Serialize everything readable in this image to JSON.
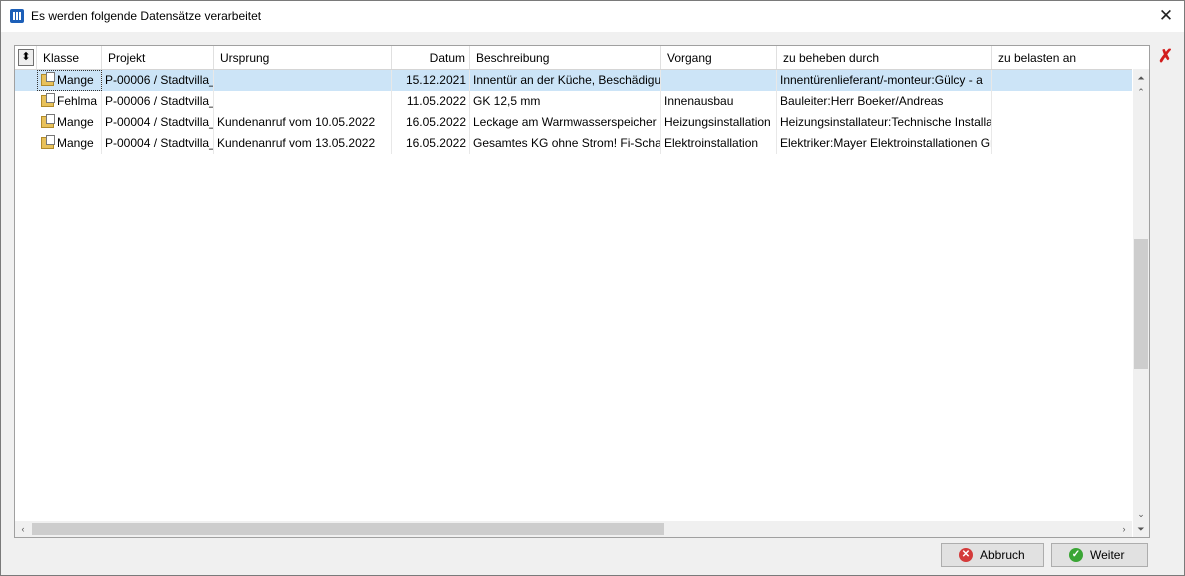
{
  "window": {
    "title": "Es werden folgende Datensätze verarbeitet"
  },
  "columns": [
    "Klasse",
    "Projekt",
    "Ursprung",
    "Datum",
    "Beschreibung",
    "Vorgang",
    "zu beheben durch",
    "zu belasten an"
  ],
  "rows": [
    {
      "klasse": "Mange",
      "projekt": "P-00006 / Stadtvilla_",
      "ursprung": "",
      "datum": "15.12.2021",
      "beschreibung": "Innentür an der Küche, Beschädigu",
      "vorgang": "",
      "beheben": "Innentürenlieferant/-monteur:Gülcy - a",
      "belasten": ""
    },
    {
      "klasse": "Fehlma",
      "projekt": "P-00006 / Stadtvilla_",
      "ursprung": "",
      "datum": "11.05.2022",
      "beschreibung": "GK 12,5 mm",
      "vorgang": "Innenausbau",
      "beheben": "Bauleiter:Herr Boeker/Andreas",
      "belasten": ""
    },
    {
      "klasse": "Mange",
      "projekt": "P-00004 / Stadtvilla_",
      "ursprung": "Kundenanruf vom 10.05.2022",
      "datum": "16.05.2022",
      "beschreibung": "Leckage am Warmwasserspeicher -",
      "vorgang": "Heizungsinstallation",
      "beheben": "Heizungsinstallateur:Technische Installa",
      "belasten": ""
    },
    {
      "klasse": "Mange",
      "projekt": "P-00004 / Stadtvilla_",
      "ursprung": "Kundenanruf vom 13.05.2022",
      "datum": "16.05.2022",
      "beschreibung": "Gesamtes KG ohne Strom! Fi-Schalt",
      "vorgang": "Elektroinstallation",
      "beheben": "Elektriker:Mayer Elektroinstallationen Gr",
      "belasten": ""
    }
  ],
  "buttons": {
    "cancel": "Abbruch",
    "next": "Weiter"
  },
  "icons": {
    "app": "app-icon",
    "close": "close-icon",
    "delete": "red-x-icon",
    "sort": "sort-arrows-icon",
    "record": "folder-check-icon"
  }
}
